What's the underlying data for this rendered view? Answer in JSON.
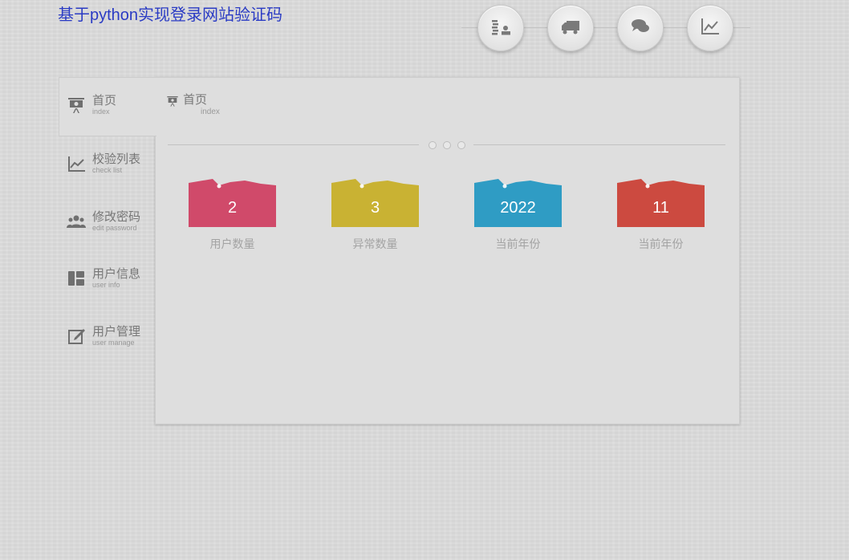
{
  "header": {
    "title": "基于python实现登录网站验证码",
    "nav_icons": [
      "money-icon",
      "truck-icon",
      "chat-icon",
      "line-chart-icon"
    ]
  },
  "sidebar": {
    "items": [
      {
        "label": "首页",
        "sublabel": "index",
        "icon": "presentation-board-icon"
      },
      {
        "label": "校验列表",
        "sublabel": "check list",
        "icon": "line-chart-icon"
      },
      {
        "label": "修改密码",
        "sublabel": "edit password",
        "icon": "users-icon"
      },
      {
        "label": "用户信息",
        "sublabel": "user info",
        "icon": "layout-icon"
      },
      {
        "label": "用户管理",
        "sublabel": "user manage",
        "icon": "edit-icon"
      }
    ]
  },
  "breadcrumb": {
    "label": "首页",
    "sublabel": "index"
  },
  "stats": [
    {
      "value": "2",
      "label": "用户数量",
      "color": "#d04a6a"
    },
    {
      "value": "3",
      "label": "异常数量",
      "color": "#c9b233"
    },
    {
      "value": "2022",
      "label": "当前年份",
      "color": "#2f9cc4"
    },
    {
      "value": "11",
      "label": "当前年份",
      "color": "#cc4a40"
    }
  ]
}
